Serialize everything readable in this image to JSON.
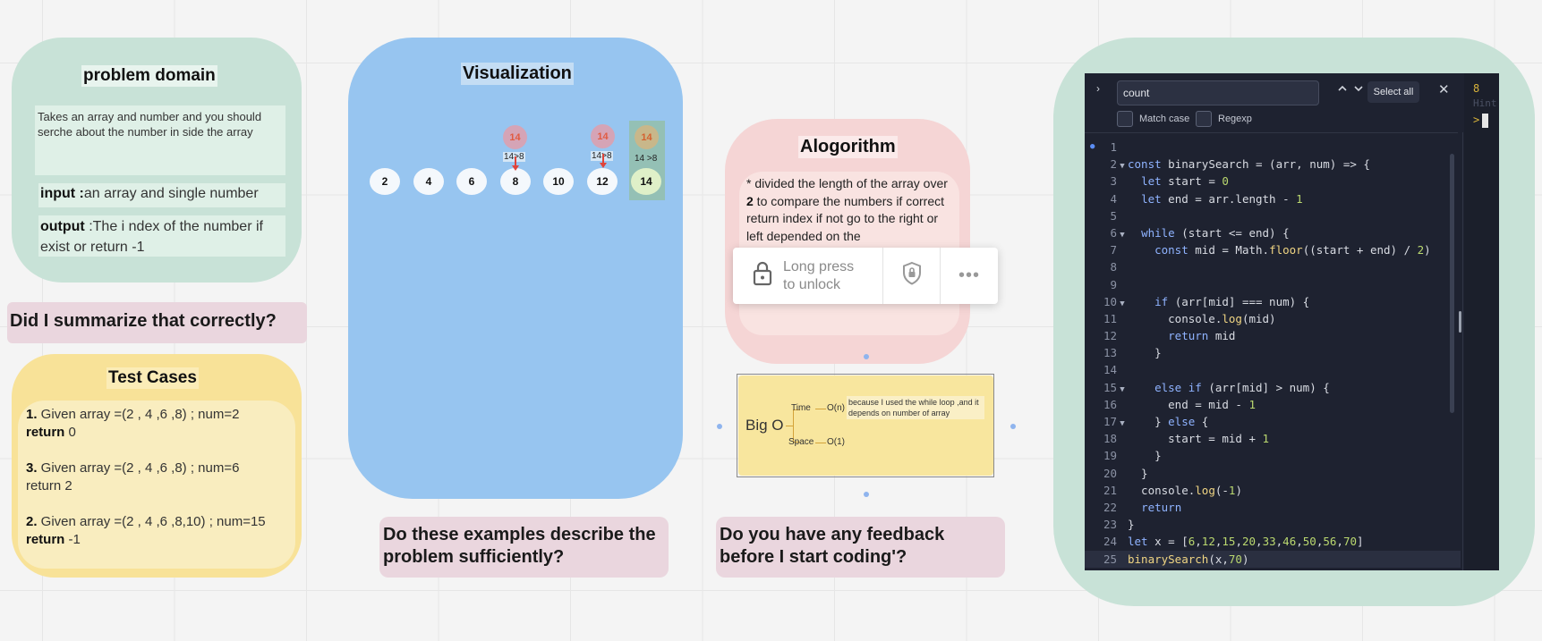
{
  "problem_domain": {
    "title": "problem domain",
    "description": "Takes an array and number and you should serche about the number in side the array",
    "input_label": "input :",
    "input_text": "an array and single number",
    "output_label": "output",
    "output_text": " :The i ndex of the number if exist or return -1"
  },
  "notes": {
    "summarize": "Did I summarize that correctly?",
    "examples": "Do these examples describe the problem sufficiently?",
    "feedback": "Do you have any feedback before I start coding'?"
  },
  "test_cases": {
    "title": "Test Cases",
    "case1_num": "1.",
    "case1_text": " Given array =(2 ,  4  ,6  ,8)  ; num=2",
    "case1_return_label": "return",
    "case1_return_value": " 0",
    "case3_num": "3.",
    "case3_text": "  Given array =(2 , 4  ,6  ,8)  ; num=6",
    "case3_return": "return 2",
    "case2_num": "2.",
    "case2_text": " Given array =(2 , 4  ,6  ,8,10)  ; num=15",
    "case2_return_label": "return",
    "case2_return_value": " -1"
  },
  "visualization": {
    "title": "Visualization",
    "cells": [
      "2",
      "4",
      "6",
      "8",
      "10",
      "12",
      "14"
    ],
    "pointer_value": "14",
    "comparison": "14>8",
    "comparison_2": "14>8",
    "comparison_3": "14 >8"
  },
  "algorithm": {
    "title": "Alogorithm",
    "text_pre": "* divided the length of the array over ",
    "text_bold": "2",
    "text_post": " to compare the numbers if correct return index if not go to the right or left depended on the"
  },
  "lock_toast": {
    "line1": "Long press",
    "line2": "to unlock",
    "more": "•••",
    "lock_icon": "lock-icon",
    "shield_icon": "shield-lock-icon"
  },
  "big_o": {
    "label": "Big O",
    "time_label": "Time",
    "time_value": "O(n)",
    "space_label": "Space",
    "space_value": "O(1)",
    "note": "because I used the while loop ,and it depends on number of array"
  },
  "editor": {
    "search_value": "count",
    "select_all": "Select all",
    "match_case": "Match case",
    "regexp": "Regexp",
    "side_number": "8",
    "side_hint": "Hint",
    "side_prompt": ">"
  }
}
